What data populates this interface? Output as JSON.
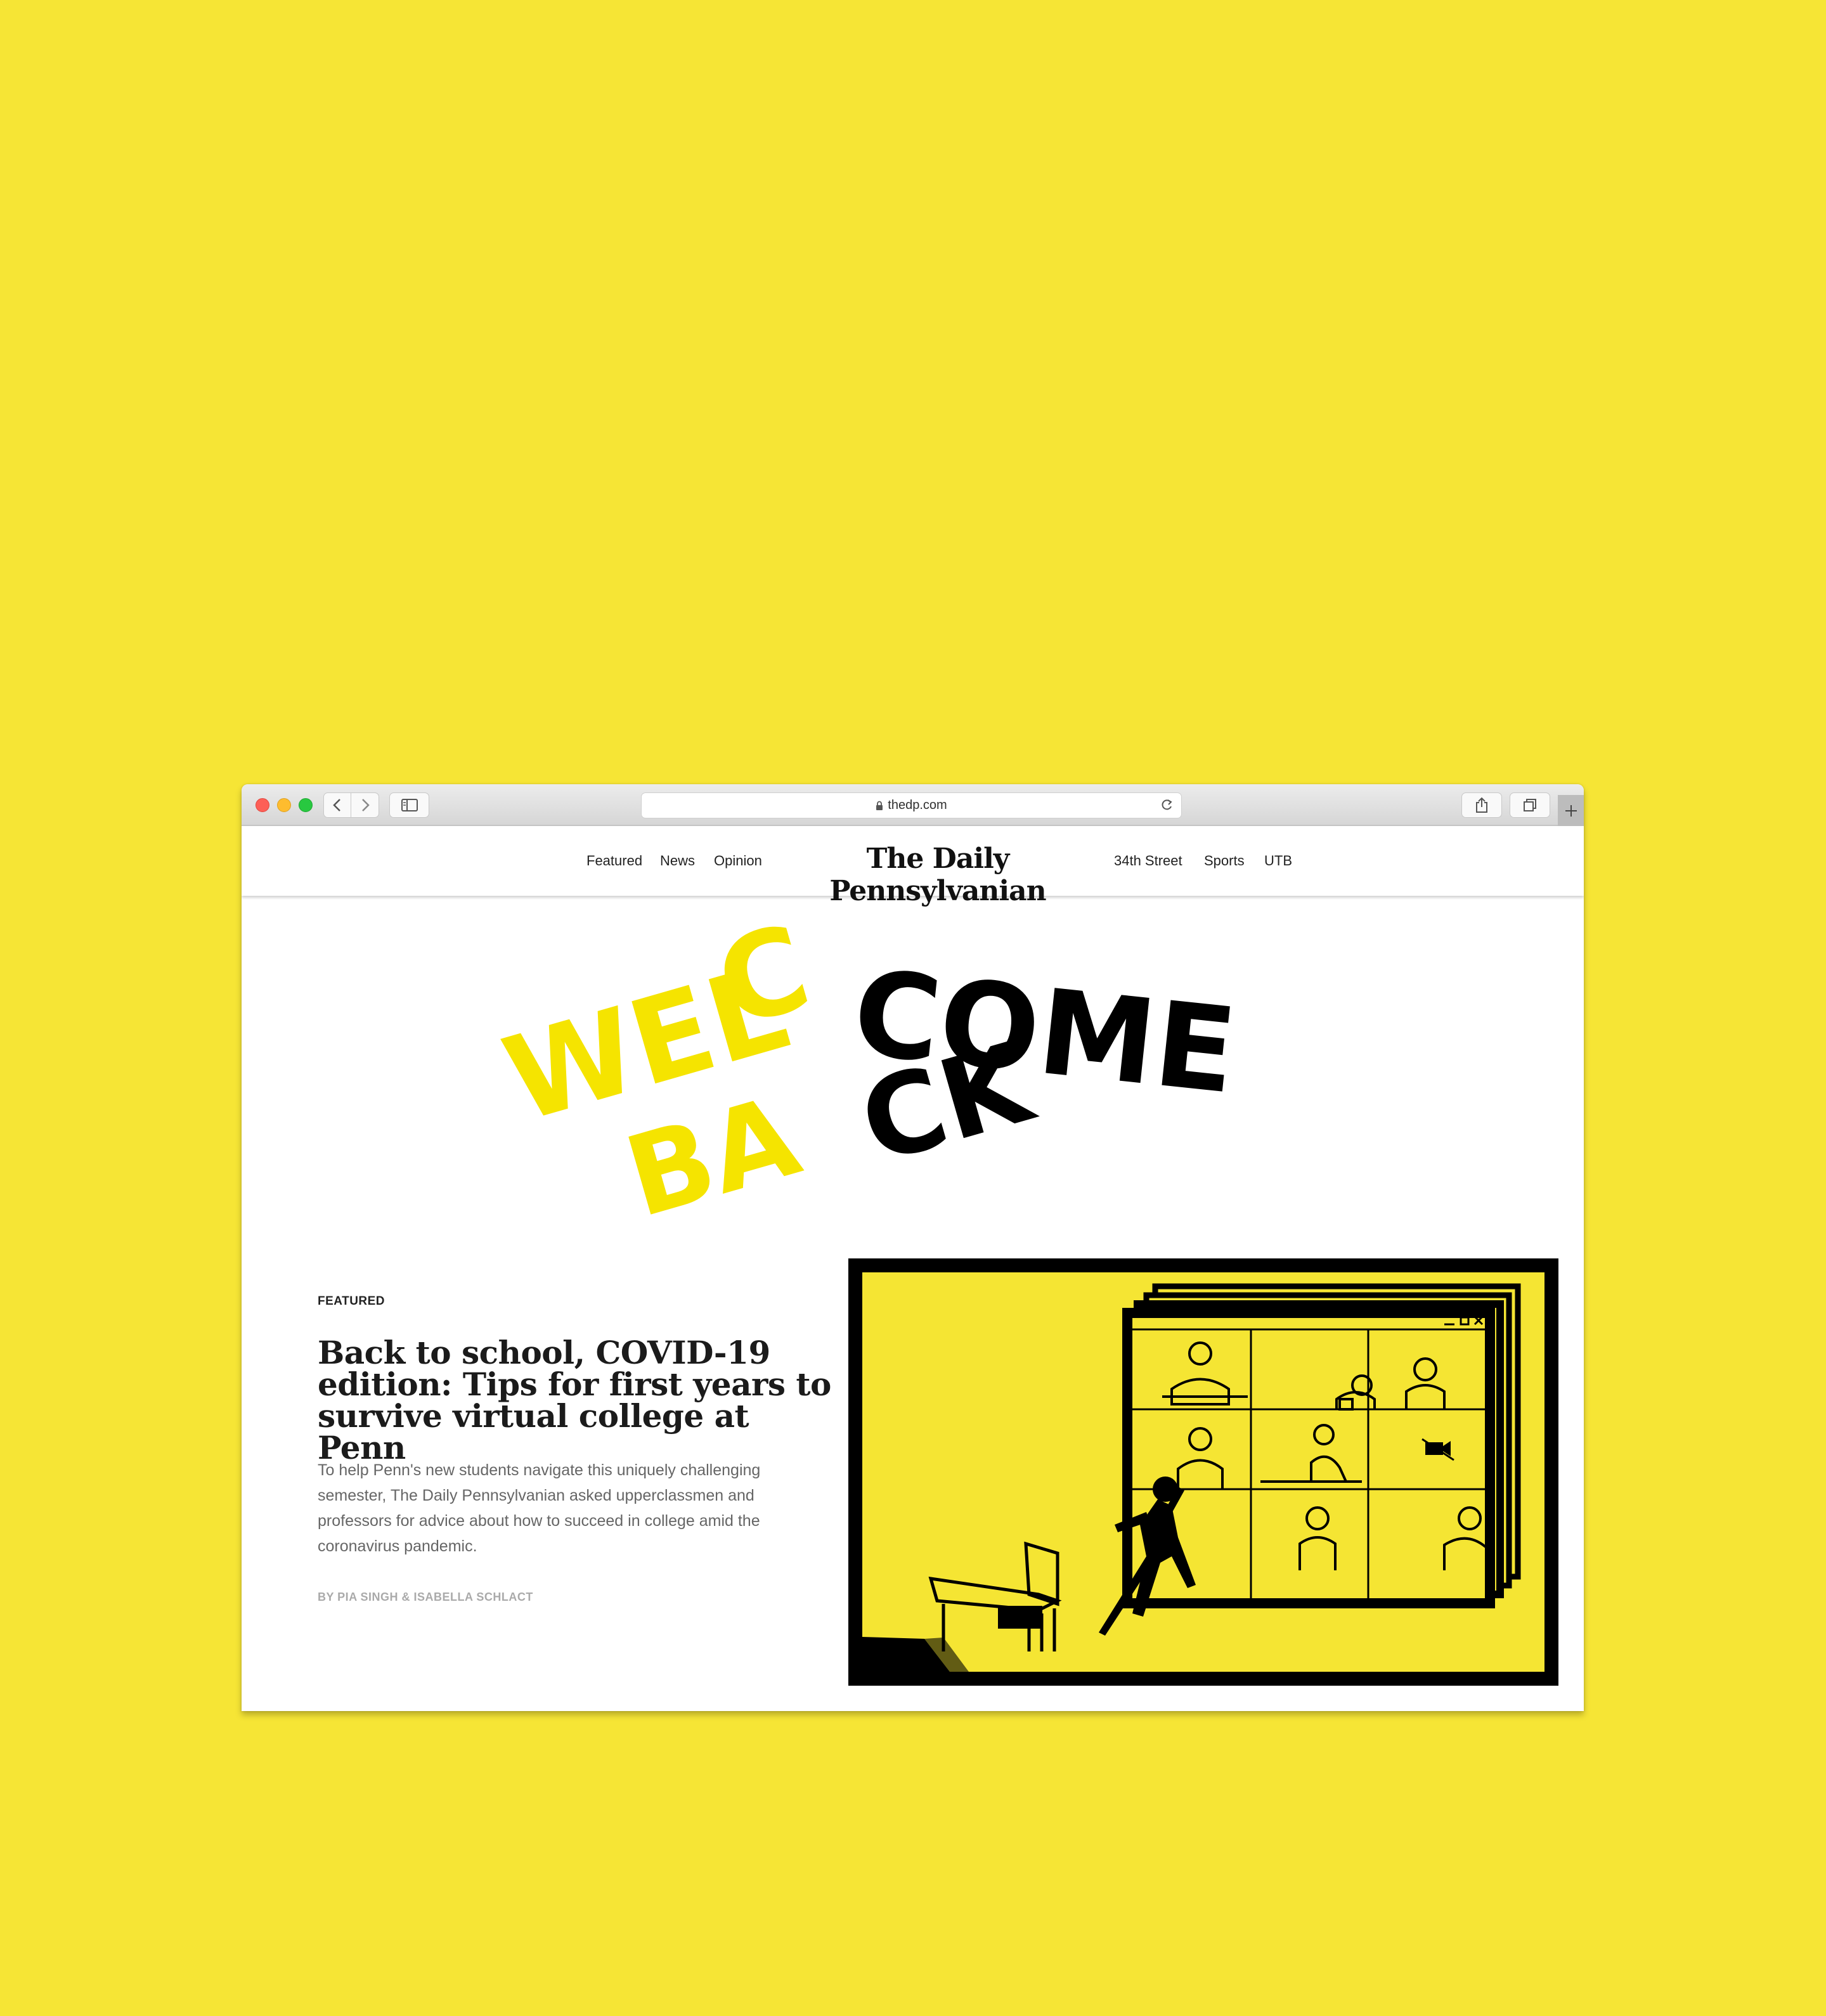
{
  "browser": {
    "url": "thedp.com",
    "icons": [
      "back-icon",
      "forward-icon",
      "sidebar-icon",
      "lock-icon",
      "reload-icon",
      "share-icon",
      "tabs-icon",
      "plus-icon"
    ]
  },
  "nav": {
    "left": [
      "Featured",
      "News",
      "Opinion"
    ],
    "masthead": "The Daily Pennsylvanian",
    "right": [
      "34th Street",
      "Sports",
      "UTB"
    ]
  },
  "hero": {
    "word1": "WELCOME",
    "word2": "BACK",
    "colors": {
      "yellow": "#f5e400",
      "black": "#000000"
    }
  },
  "article": {
    "kicker": "FEATURED",
    "headline": "Back to school, COVID-19 edition: Tips for first years to survive virtual college at Penn",
    "dek": "To help Penn's new students navigate this uniquely challenging semester, The Daily Pennsylvanian asked upperclassmen and professors for advice about how to succeed in college amid the coronavirus pandemic.",
    "byline": "BY PIA SINGH & ISABELLA SCHLACT"
  },
  "colors": {
    "page_bg": "#f6e535",
    "illustration_yellow": "#f5e533"
  }
}
